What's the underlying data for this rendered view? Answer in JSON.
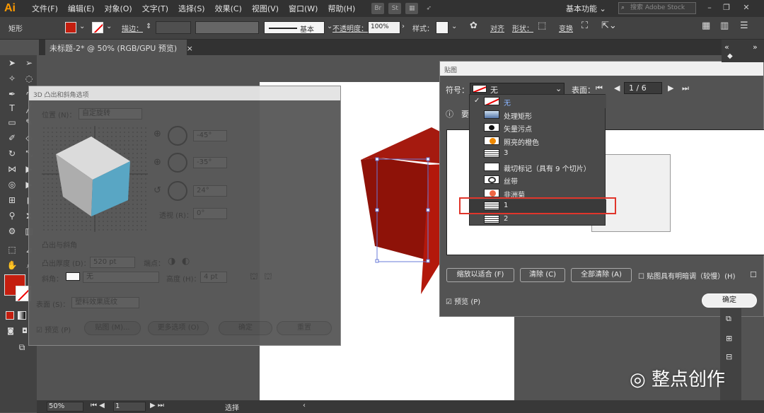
{
  "app": {
    "logo": "Ai",
    "menus": [
      "文件(F)",
      "编辑(E)",
      "对象(O)",
      "文字(T)",
      "选择(S)",
      "效果(C)",
      "视图(V)",
      "窗口(W)",
      "帮助(H)"
    ],
    "bridge": "Br",
    "stock": "St",
    "workspace": "基本功能",
    "search_placeholder": "搜索 Adobe Stock"
  },
  "control": {
    "object_type": "矩形",
    "stroke_label": "描边：",
    "stroke_style": "基本",
    "opacity_label": "不透明度：",
    "opacity_value": "100%",
    "style_label": "样式：",
    "align_label": "对齐",
    "shape_label": "形状：",
    "transform_label": "变换",
    "colors": {
      "fill": "#c41e0f"
    }
  },
  "doc_tab": {
    "title": "未标题-2* @ 50% (RGB/GPU 预览)",
    "close": "×"
  },
  "status": {
    "zoom": "50%",
    "page": "1",
    "mode": "选择"
  },
  "dialog3d": {
    "title": "3D 凸出和斜角选项",
    "position_label": "位置 (N)：",
    "position_value": "自定旋转",
    "angle_x": "-45°",
    "angle_y": "-35°",
    "angle_z": "24°",
    "perspective_label": "透视 (R)：",
    "perspective_value": "0°",
    "extrude_section": "凸出与斜角",
    "depth_label": "凸出厚度 (D)：",
    "depth_value": "520 pt",
    "cap_label": "端点：",
    "bevel_label": "斜角：",
    "bevel_value": "无",
    "height_label": "高度 (H)：",
    "height_value": "4 pt",
    "surface_label": "表面 (S)：",
    "surface_value": "塑料效果底纹",
    "preview_label": "预览 (P)",
    "map_button": "贴图 (M)...",
    "more_button": "更多选项 (O)",
    "ok": "确定",
    "reset": "重置",
    "cube_colors": {
      "top": "#e0e0e0",
      "left": "#b0b0b0",
      "right": "#5aa9c8"
    }
  },
  "mapart": {
    "title": "贴图",
    "symbol_label": "符号：",
    "symbol_value": "无",
    "surface_label": "表面：",
    "surface_value": "1 / 6",
    "info_prefix": "要",
    "fit_button": "缩放以适合 (F)",
    "clear_button": "清除 (C)",
    "clear_all_button": "全部清除 (A)",
    "shade_label": "贴图具有明暗调（较慢）(H)",
    "preview_label": "预览 (P)",
    "ok": "确定",
    "symbols": [
      {
        "label": "无",
        "checked": true
      },
      {
        "label": "处理矩形"
      },
      {
        "label": "矢量污点"
      },
      {
        "label": "照亮的橙色"
      },
      {
        "label": "3"
      },
      {
        "label": "裁切标记（具有 9 个切片）"
      },
      {
        "label": "丝带"
      },
      {
        "label": "非洲菊"
      },
      {
        "label": "1",
        "highlighted": true
      },
      {
        "label": "2"
      }
    ]
  },
  "watermark": "整点创作"
}
